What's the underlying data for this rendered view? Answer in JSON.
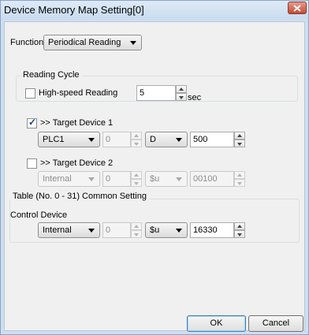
{
  "window": {
    "title": "Device Memory Map Setting[0]"
  },
  "function": {
    "label": "Function",
    "value": "Periodical Reading"
  },
  "reading_cycle": {
    "group_title": "Reading Cycle",
    "high_speed_label": "High-speed Reading",
    "high_speed_checked": false,
    "value": "5",
    "unit": "sec"
  },
  "target_device_1": {
    "label": ">> Target Device 1",
    "checked": true,
    "plc": "PLC1",
    "station": "0",
    "device": "D",
    "address": "500"
  },
  "target_device_2": {
    "label": ">> Target Device 2",
    "checked": false,
    "plc": "Internal",
    "station": "0",
    "device": "$u",
    "address": "00100"
  },
  "common_setting": {
    "group_title": "Table (No. 0 - 31) Common Setting",
    "control_device_label": "Control Device",
    "plc": "Internal",
    "station": "0",
    "device": "$u",
    "address": "16330"
  },
  "buttons": {
    "ok": "OK",
    "cancel": "Cancel"
  },
  "icons": {
    "close": "close-icon"
  }
}
